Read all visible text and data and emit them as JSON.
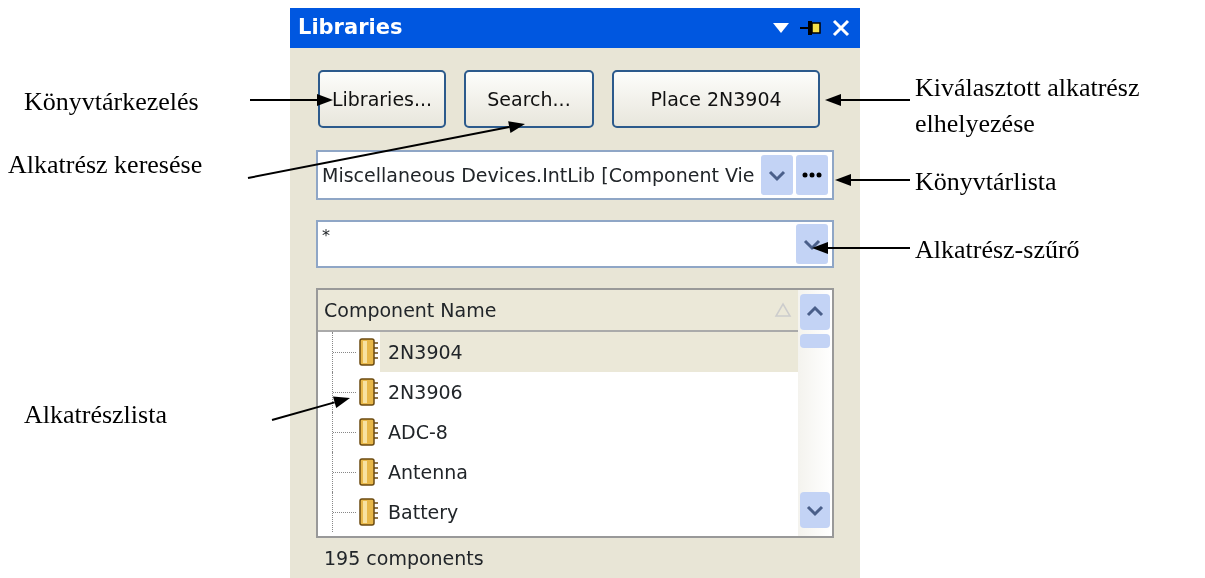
{
  "panel": {
    "title": "Libraries",
    "buttons": [
      {
        "label": "Libraries..."
      },
      {
        "label": "Search..."
      },
      {
        "label": "Place 2N3904"
      }
    ],
    "library_select": {
      "value": "Miscellaneous Devices.IntLib [Component Vie"
    },
    "filter": {
      "value": "*"
    },
    "list": {
      "columns": [
        "Component Name"
      ],
      "rows": [
        {
          "name": "2N3904",
          "selected": true
        },
        {
          "name": "2N3906",
          "selected": false
        },
        {
          "name": "ADC-8",
          "selected": false
        },
        {
          "name": "Antenna",
          "selected": false
        },
        {
          "name": "Battery",
          "selected": false
        }
      ]
    },
    "status": "195 components"
  },
  "annotations": {
    "left": [
      "Könyvtárkezelés",
      "Alkatrész keresése",
      "Alkatrészlista"
    ],
    "right": [
      "Kiválasztott alkatrész elhelyezése",
      "Könyvtárlista",
      "Alkatrész-szűrő"
    ]
  }
}
